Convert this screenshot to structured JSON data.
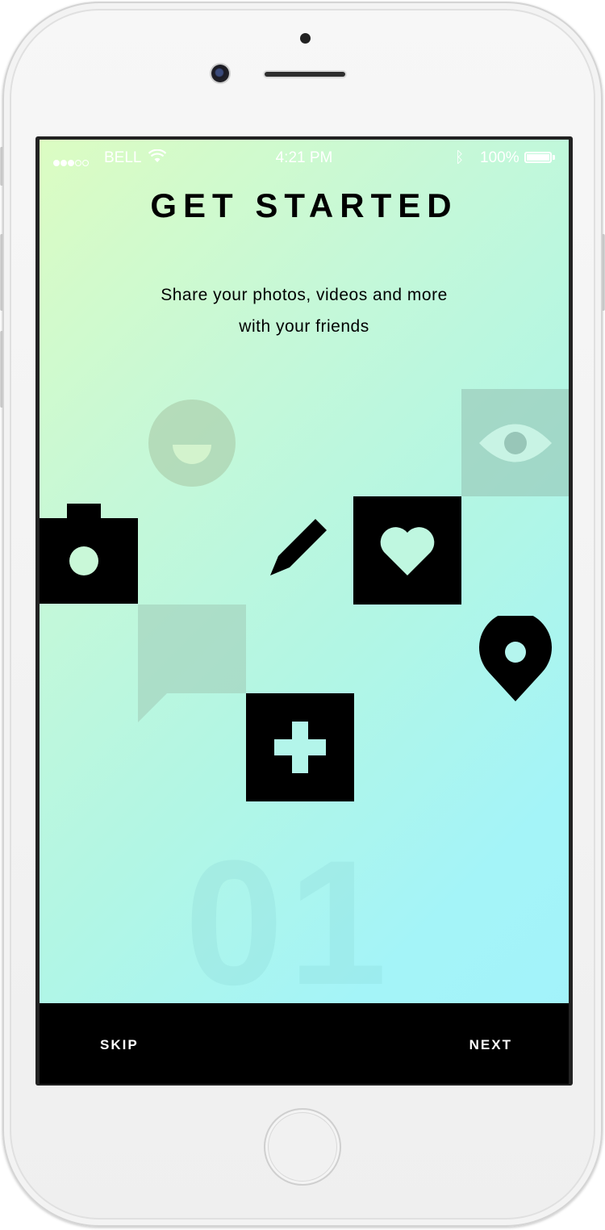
{
  "status_bar": {
    "carrier": "BELL",
    "time": "4:21 PM",
    "battery": "100%",
    "bluetooth_icon": "ᛒ"
  },
  "onboarding": {
    "title": "GET STARTED",
    "subtitle_line1": "Share your photos, videos and more",
    "subtitle_line2": "with your friends",
    "step_number": "01"
  },
  "icons": [
    "smiley-icon",
    "eye-icon",
    "camera-icon",
    "pencil-icon",
    "heart-icon",
    "chat-bubble-icon",
    "location-pin-icon",
    "plus-icon"
  ],
  "actions": {
    "skip": "SKIP",
    "next": "NEXT"
  },
  "colors": {
    "gradient_start": "#dcfcc2",
    "gradient_end": "#a2f2fb",
    "bar": "#000000"
  }
}
